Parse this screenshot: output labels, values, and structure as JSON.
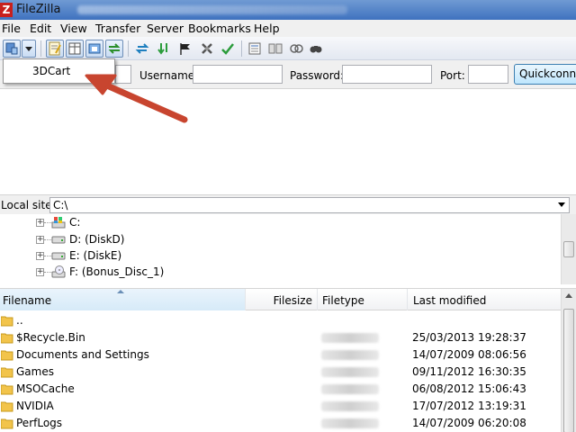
{
  "window": {
    "title": "FileZilla",
    "icon": "filezilla-icon"
  },
  "menubar": {
    "items": [
      "File",
      "Edit",
      "View",
      "Transfer",
      "Server",
      "Bookmarks",
      "Help"
    ]
  },
  "toolbar": {
    "icons": [
      "site-manager-icon",
      "dropdown-arrow-icon",
      "message-log-icon",
      "directory-tree-icon",
      "remote-tree-icon",
      "transfer-queue-icon",
      "refresh-icon",
      "process-queue-icon",
      "cancel-icon",
      "disconnect-icon",
      "reconnect-icon",
      "filter-icon",
      "compare-icon",
      "sync-browse-icon",
      "search-icon"
    ]
  },
  "quickconnect": {
    "host_value": "",
    "username_label": "Username:",
    "username_value": "",
    "password_label": "Password:",
    "password_value": "",
    "port_label": "Port:",
    "port_value": "",
    "button_label": "Quickconnect"
  },
  "site_dropdown": {
    "items": [
      "3DCart"
    ]
  },
  "local_site": {
    "label": "Local site:",
    "path": "C:\\",
    "tree": [
      {
        "label": "C:",
        "icon": "system-drive-icon"
      },
      {
        "label": "D: (DiskD)",
        "icon": "drive-icon"
      },
      {
        "label": "E: (DiskE)",
        "icon": "drive-icon"
      },
      {
        "label": "F: (Bonus_Disc_1)",
        "icon": "cd-drive-icon"
      }
    ]
  },
  "file_list": {
    "columns": [
      "Filename",
      "Filesize",
      "Filetype",
      "Last modified"
    ],
    "rows": [
      {
        "name": "..",
        "modified": ""
      },
      {
        "name": "$Recycle.Bin",
        "modified": "25/03/2013 19:28:37"
      },
      {
        "name": "Documents and Settings",
        "modified": "14/07/2009 08:06:56"
      },
      {
        "name": "Games",
        "modified": "09/11/2012 16:30:35"
      },
      {
        "name": "MSOCache",
        "modified": "06/08/2012 15:06:43"
      },
      {
        "name": "NVIDIA",
        "modified": "17/07/2012 13:19:31"
      },
      {
        "name": "PerfLogs",
        "modified": "14/07/2009 06:20:08"
      }
    ]
  },
  "colors": {
    "arrow": "#c8452f",
    "folder": "#f2c44b",
    "titlebar": "#4f7fc4"
  }
}
